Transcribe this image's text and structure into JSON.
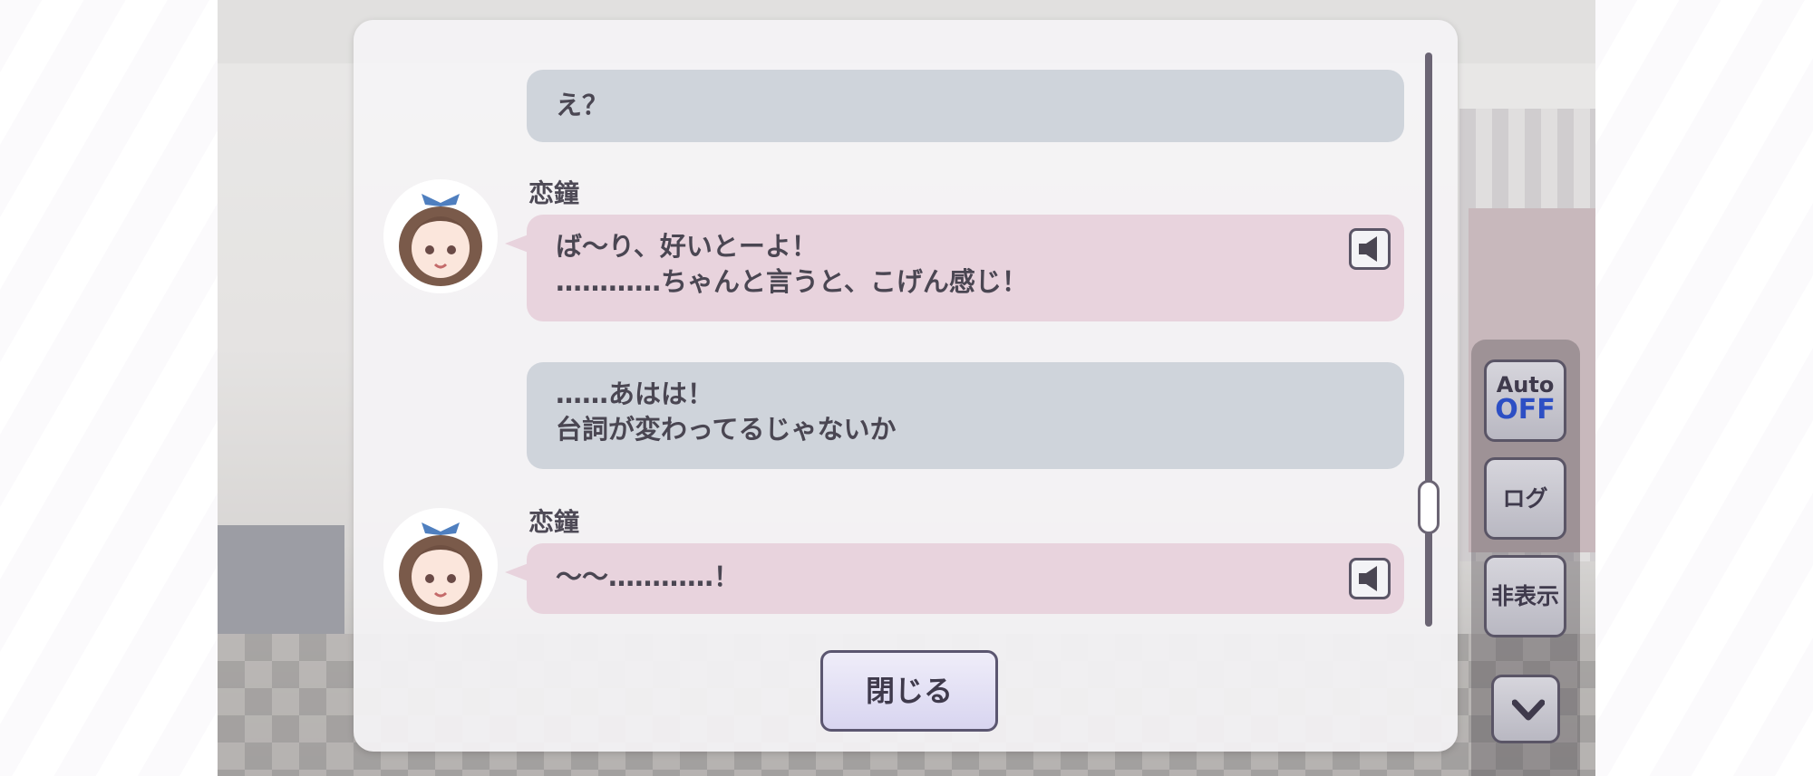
{
  "log": {
    "entries": [
      {
        "type": "narration",
        "lines": [
          "え？"
        ]
      },
      {
        "type": "speaker",
        "speaker": "恋鐘",
        "lines": [
          "ば〜り、好いとーよ！",
          "…………ちゃんと言うと、こげん感じ！"
        ],
        "voice_icon": "speaker-icon"
      },
      {
        "type": "narration",
        "lines": [
          "……あはは！",
          "台詞が変わってるじゃないか"
        ]
      },
      {
        "type": "speaker",
        "speaker": "恋鐘",
        "lines": [
          "〜〜…………！"
        ],
        "voice_icon": "speaker-icon"
      }
    ],
    "close_label": "閉じる"
  },
  "controls": {
    "auto_label": "Auto",
    "auto_state": "OFF",
    "log_label": "ログ",
    "hide_label": "非表示",
    "down_icon": "chevron-down-icon"
  },
  "colors": {
    "narration_bubble": "#cfd4db",
    "speaker_bubble": "#e8d3dd",
    "auto_off": "#2d4fc4"
  }
}
